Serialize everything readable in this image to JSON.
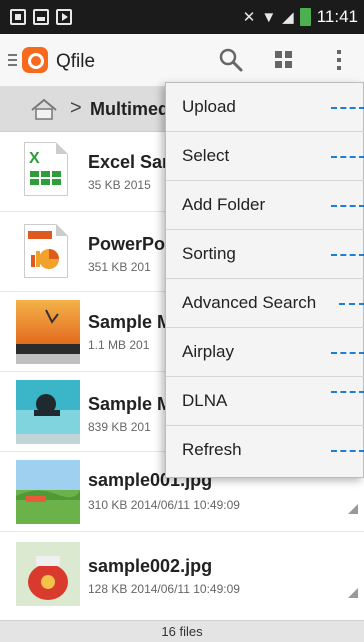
{
  "status_bar": {
    "time": "11:41"
  },
  "app": {
    "title": "Qfile"
  },
  "breadcrumb": {
    "folder": "Multimed"
  },
  "files": [
    {
      "name": "Excel Sar",
      "size": "35 KB",
      "date": "2015"
    },
    {
      "name": "PowerPoi",
      "size": "351 KB",
      "date": "201"
    },
    {
      "name": "Sample M",
      "size": "1.1 MB",
      "date": "201"
    },
    {
      "name": "Sample M",
      "size": "839 KB",
      "date": "201"
    },
    {
      "name": "sample001.jpg",
      "size": "310 KB",
      "date": "2014/06/11 10:49:09"
    },
    {
      "name": "sample002.jpg",
      "size": "128 KB",
      "date": "2014/06/11 10:49:09"
    }
  ],
  "footer": {
    "count": "16 files"
  },
  "menu": {
    "items": [
      {
        "label": "Upload"
      },
      {
        "label": "Select"
      },
      {
        "label": "Add Folder"
      },
      {
        "label": "Sorting"
      },
      {
        "label": "Advanced Search"
      },
      {
        "label": "Airplay"
      },
      {
        "label": "DLNA"
      },
      {
        "label": "Refresh"
      }
    ]
  },
  "icons": {
    "app_logo": "qfile-logo",
    "search": "search-icon",
    "view": "grid-view-icon",
    "overflow": "more-vertical-icon",
    "home": "home-icon"
  },
  "colors": {
    "accent": "#f56a1c",
    "annotation": "#1e7fd6",
    "status_bar": "#1b1b1b"
  }
}
